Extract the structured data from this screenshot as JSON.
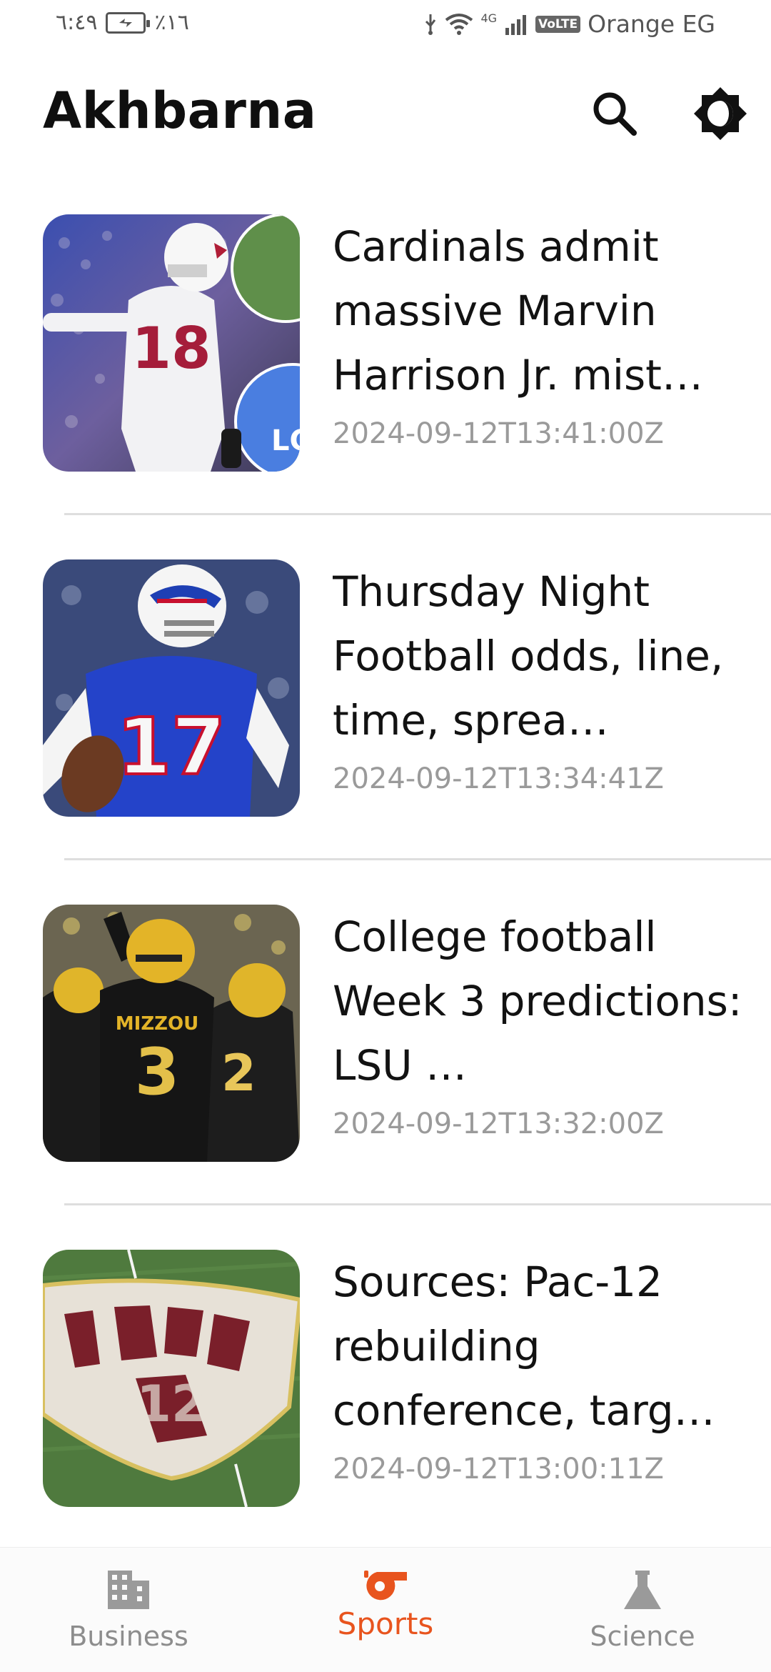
{
  "status_bar": {
    "time": "٦:٤٩",
    "battery": "٪١٦",
    "network": "4G",
    "volte": "VoLTE",
    "carrier": "Orange EG"
  },
  "app": {
    "title": "Akhbarna"
  },
  "icons": {
    "search": "search-icon",
    "theme": "brightness-icon"
  },
  "articles": [
    {
      "headline": "Cardinals admit massive Marvin Harrison Jr. mist…",
      "published_at": "2024-09-12T13:41:00Z"
    },
    {
      "headline": "Thursday Night Football odds, line, time, sprea…",
      "published_at": "2024-09-12T13:34:41Z"
    },
    {
      "headline": "College football Week 3 predictions: LSU …",
      "published_at": "2024-09-12T13:32:00Z"
    },
    {
      "headline": "Sources: Pac-12 rebuilding conference, targ…",
      "published_at": "2024-09-12T13:00:11Z"
    }
  ],
  "bottom_nav": {
    "items": [
      {
        "label": "Business",
        "icon": "building-icon",
        "active": false
      },
      {
        "label": "Sports",
        "icon": "whistle-icon",
        "active": true
      },
      {
        "label": "Science",
        "icon": "flask-icon",
        "active": false
      }
    ]
  },
  "colors": {
    "accent": "#e8541e",
    "inactive": "#8d8d8d",
    "timestamp": "#9a9a9a"
  }
}
